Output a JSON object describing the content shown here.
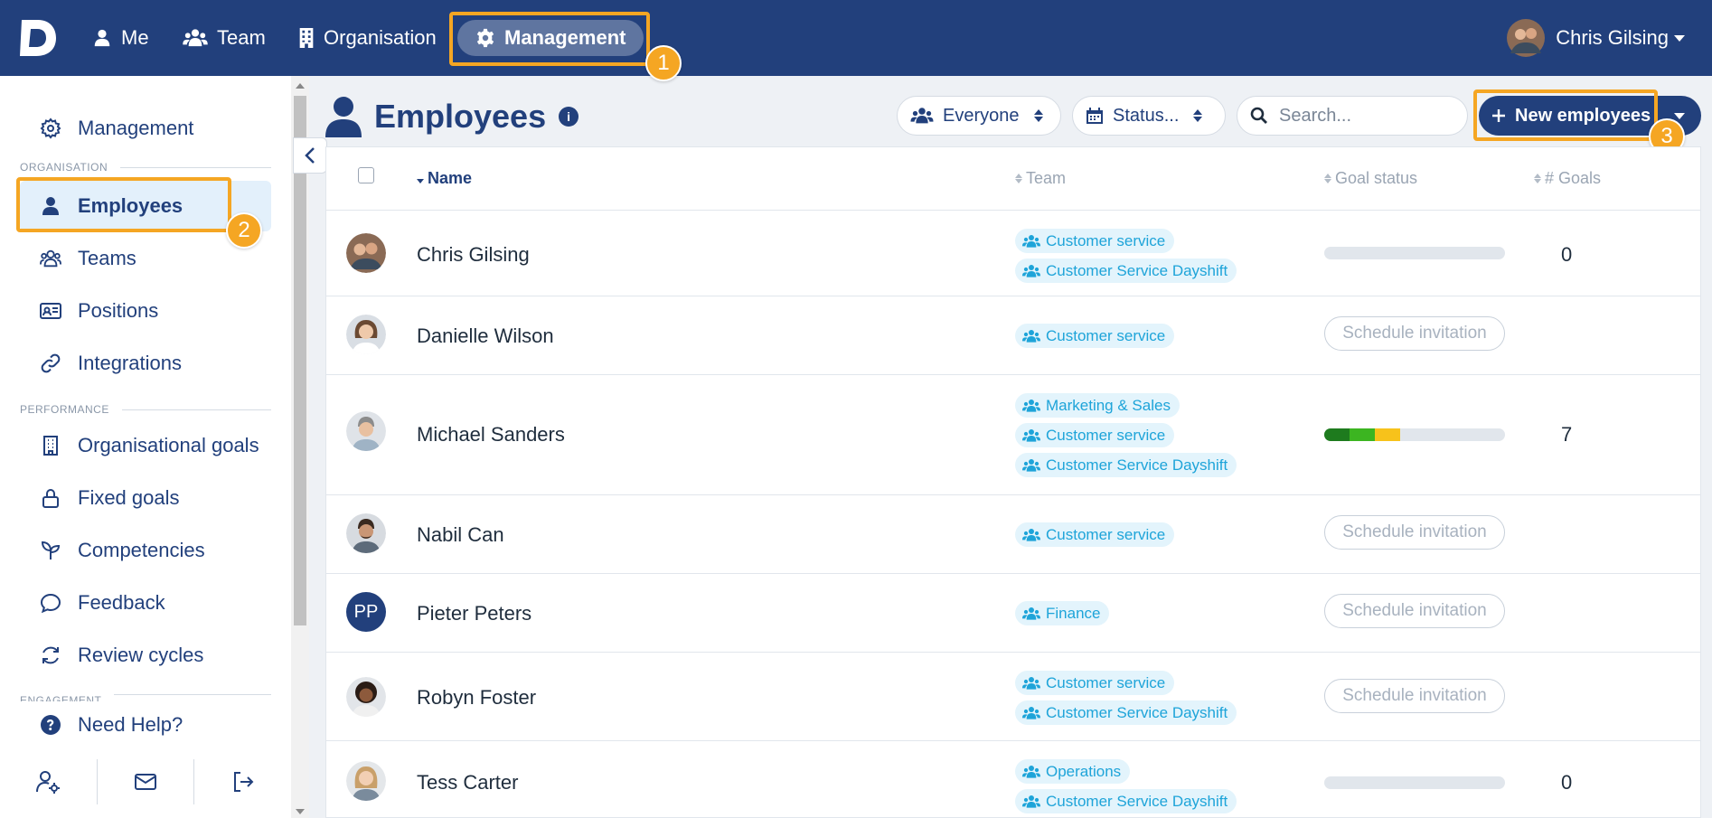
{
  "nav": {
    "items": [
      {
        "label": "Me",
        "icon": "user-icon"
      },
      {
        "label": "Team",
        "icon": "users-icon"
      },
      {
        "label": "Organisation",
        "icon": "building-icon"
      },
      {
        "label": "Management",
        "icon": "gear-icon",
        "active": true
      }
    ],
    "user_name": "Chris Gilsing"
  },
  "callouts": [
    "1",
    "2",
    "3"
  ],
  "sidebar": {
    "top_item": "Management",
    "section_organisation": "ORGANISATION",
    "organisation_items": [
      "Employees",
      "Teams",
      "Positions",
      "Integrations"
    ],
    "section_performance": "PERFORMANCE",
    "performance_items": [
      "Organisational goals",
      "Fixed goals",
      "Competencies",
      "Feedback",
      "Review cycles"
    ],
    "section_engagement": "ENGAGEMENT",
    "help": "Need Help?"
  },
  "page": {
    "title": "Employees",
    "info": "i",
    "filter_everyone": "Everyone",
    "filter_status": "Status...",
    "search_placeholder": "Search...",
    "new_button": "New employees"
  },
  "table": {
    "columns": [
      "Name",
      "Team",
      "Goal status",
      "# Goals"
    ],
    "rows": [
      {
        "name": "Chris Gilsing",
        "teams": [
          "Customer service",
          "Customer Service Dayshift"
        ],
        "goal_status": "bar",
        "goals": "0"
      },
      {
        "name": "Danielle Wilson",
        "teams": [
          "Customer service"
        ],
        "goal_status": "Schedule invitation",
        "goals": ""
      },
      {
        "name": "Michael Sanders",
        "teams": [
          "Marketing & Sales",
          "Customer service",
          "Customer Service Dayshift"
        ],
        "goal_status": "bar",
        "goals": "7"
      },
      {
        "name": "Nabil Can",
        "teams": [
          "Customer service"
        ],
        "goal_status": "Schedule invitation",
        "goals": ""
      },
      {
        "name": "Pieter Peters",
        "initials": "PP",
        "teams": [
          "Finance"
        ],
        "goal_status": "Schedule invitation",
        "goals": ""
      },
      {
        "name": "Robyn Foster",
        "teams": [
          "Customer service",
          "Customer Service Dayshift"
        ],
        "goal_status": "Schedule invitation",
        "goals": ""
      },
      {
        "name": "Tess Carter",
        "teams": [
          "Operations",
          "Customer Service Dayshift"
        ],
        "goal_status": "bar",
        "goals": "0"
      }
    ]
  },
  "goal_bar_segments": {
    "michael_sanders": [
      {
        "color": "#1e7b1e",
        "fraction": 0.14
      },
      {
        "color": "#3cb521",
        "fraction": 0.14
      },
      {
        "color": "#f7c21b",
        "fraction": 0.14
      }
    ]
  },
  "colors": {
    "navbar": "#22407c",
    "accent": "#22407c",
    "tag_text": "#1ea4d9",
    "tag_bg": "#e3f4fc",
    "callout": "#f5a623"
  }
}
